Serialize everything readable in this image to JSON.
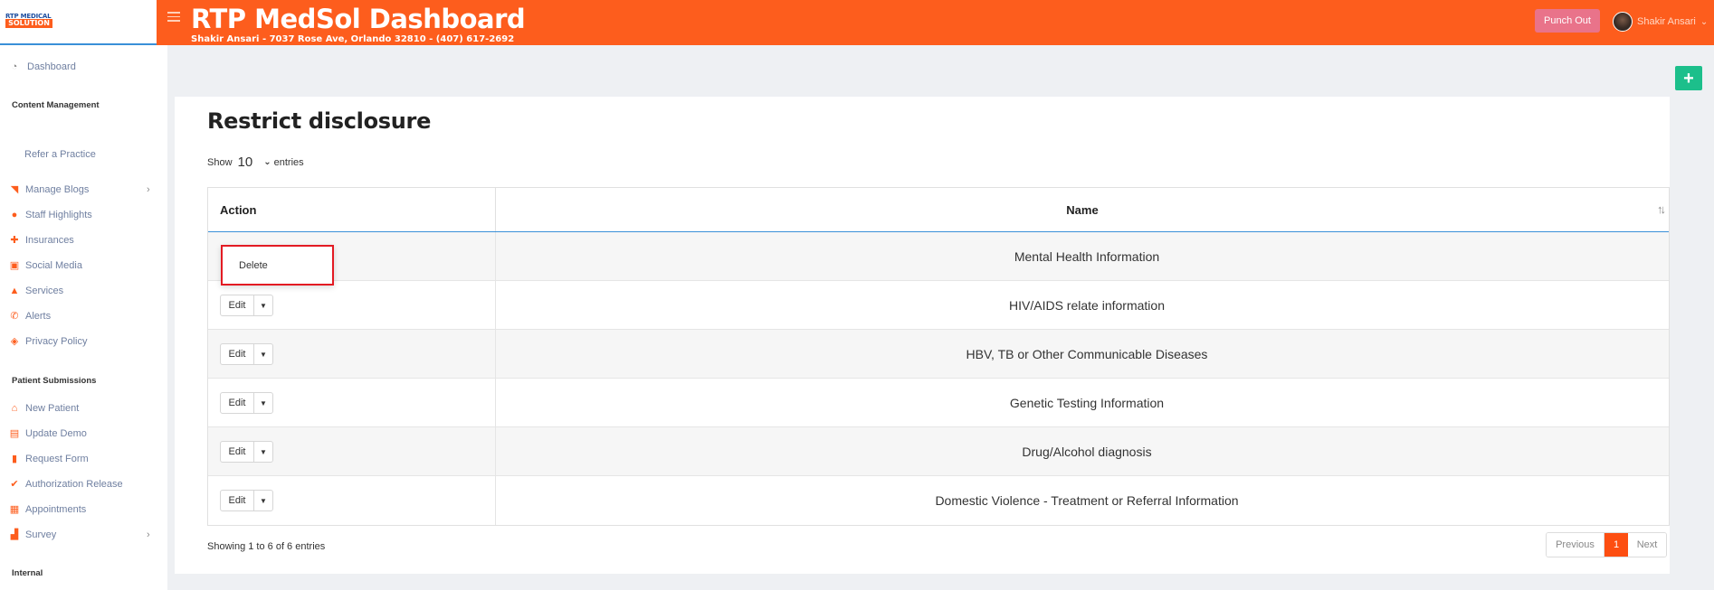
{
  "header": {
    "logo_top": "RTP MEDICAL",
    "logo_main": "SOLUTION",
    "title": "RTP MedSol Dashboard",
    "subtitle": "Shakir Ansari - 7037 Rose Ave, Orlando 32810 - (407) 617-2692",
    "punch_out_label": "Punch Out",
    "user_name": "Shakir Ansari",
    "brand_color": "#fd5d1d"
  },
  "sidebar": {
    "dashboard": "Dashboard",
    "content_management": "Content Management",
    "refer_practice": "Refer a Practice",
    "content_items": [
      {
        "label": "Manage Blogs",
        "icon": "rss-icon"
      },
      {
        "label": "Staff Highlights",
        "icon": "user-badge-icon"
      },
      {
        "label": "Insurances",
        "icon": "plus-circle-icon"
      },
      {
        "label": "Social Media",
        "icon": "photos-icon"
      },
      {
        "label": "Services",
        "icon": "bell-service-icon"
      },
      {
        "label": "Alerts",
        "icon": "phone-icon"
      },
      {
        "label": "Privacy Policy",
        "icon": "shield-icon"
      }
    ],
    "patient_submissions": "Patient Submissions",
    "patient_items": [
      {
        "label": "New Patient",
        "icon": "home-icon"
      },
      {
        "label": "Update Demo",
        "icon": "id-card-icon"
      },
      {
        "label": "Request Form",
        "icon": "file-icon"
      },
      {
        "label": "Authorization Release",
        "icon": "clipboard-check-icon"
      },
      {
        "label": "Appointments",
        "icon": "calendar-icon"
      },
      {
        "label": "Survey",
        "icon": "chart-icon"
      }
    ],
    "internal": "Internal"
  },
  "main": {
    "add_label": "+",
    "title": "Restrict disclosure",
    "show_label": "Show",
    "entries_value": "10",
    "entries_label": "entries",
    "columns": [
      "Action",
      "Name"
    ],
    "edit_label": "Edit",
    "delete_label": "Delete",
    "rows": [
      "Mental Health Information",
      "HIV/AIDS relate information",
      "HBV, TB or Other Communicable Diseases",
      "Genetic Testing Information",
      "Drug/Alcohol diagnosis",
      "Domestic Violence - Treatment or Referral Information"
    ],
    "info": "Showing 1 to 6 of 6 entries",
    "pager": {
      "previous": "Previous",
      "current": "1",
      "next": "Next"
    }
  }
}
